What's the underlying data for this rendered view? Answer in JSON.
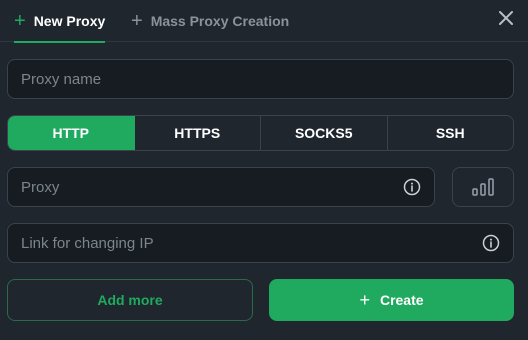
{
  "tabs": {
    "new_proxy": "New Proxy",
    "mass_creation": "Mass Proxy Creation",
    "plus_glyph": "+"
  },
  "fields": {
    "proxy_name_placeholder": "Proxy name",
    "proxy_placeholder": "Proxy",
    "change_ip_placeholder": "Link for changing IP"
  },
  "protocols": {
    "http": "HTTP",
    "https": "HTTPS",
    "socks5": "SOCKS5",
    "ssh": "SSH",
    "selected": "HTTP"
  },
  "buttons": {
    "add_more": "Add more",
    "create": "Create",
    "create_plus": "+"
  },
  "icons": {
    "close": "close-icon",
    "info": "info-icon",
    "signal": "signal-bars-icon"
  },
  "colors": {
    "accent": "#1faa5f",
    "background": "#1f262d",
    "field_background": "#161c21",
    "border": "#3a434c"
  }
}
